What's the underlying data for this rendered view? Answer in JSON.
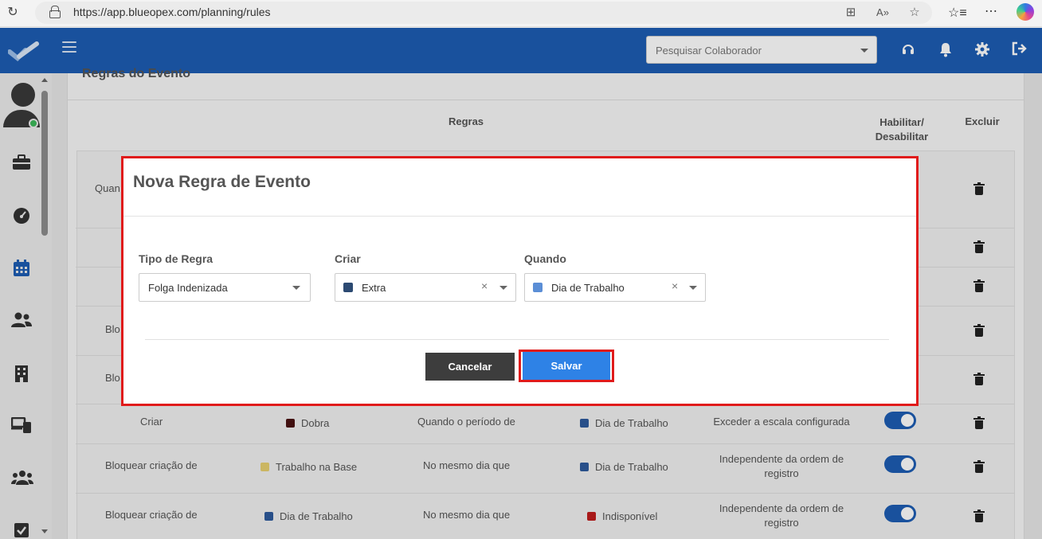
{
  "browser": {
    "url": "https://app.blueopex.com/planning/rules"
  },
  "header": {
    "search_placeholder": "Pesquisar Colaborador"
  },
  "background": {
    "section_title": "Regras do Evento",
    "columns": {
      "rules": "Regras",
      "enable": "Habilitar/ Desabilitar",
      "delete": "Excluir"
    },
    "partial_labels": [
      "Quan",
      "Blo",
      "Blo"
    ],
    "rows": [
      {
        "action": "Criar",
        "event": "Dobra",
        "event_color": "#4a1313",
        "condition": "Quando o período de",
        "target": "Dia de Trabalho",
        "target_color": "#2e5a9c",
        "constraint": "Exceder a escala configurada"
      },
      {
        "action": "Bloquear criação de",
        "event": "Trabalho na Base",
        "event_color": "#e8d070",
        "condition": "No mesmo dia que",
        "target": "Dia de Trabalho",
        "target_color": "#2e5a9c",
        "constraint": "Independente da ordem de registro"
      },
      {
        "action": "Bloquear criação de",
        "event": "Dia de Trabalho",
        "event_color": "#2e5a9c",
        "condition": "No mesmo dia que",
        "target": "Indisponível",
        "target_color": "#c01d1d",
        "constraint": "Independente da ordem de registro"
      }
    ]
  },
  "modal": {
    "title": "Nova Regra de Evento",
    "fields": {
      "rule_type": {
        "label": "Tipo de Regra",
        "value": "Folga Indenizada"
      },
      "create": {
        "label": "Criar",
        "value": "Extra",
        "color": "#2c4a72"
      },
      "when": {
        "label": "Quando",
        "value": "Dia de Trabalho",
        "color": "#5b8ed6"
      }
    },
    "cancel_label": "Cancelar",
    "save_label": "Salvar"
  }
}
